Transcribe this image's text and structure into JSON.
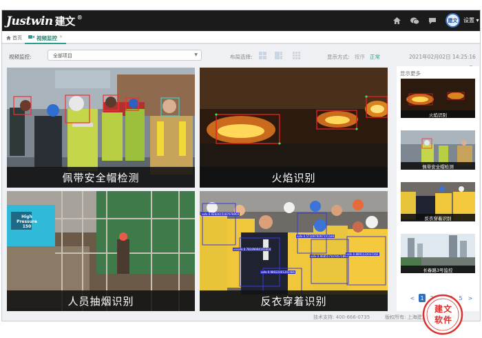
{
  "brand": {
    "logo_text": "Justwin",
    "logo_cn": "建文",
    "registered": "®"
  },
  "header": {
    "icons": [
      "home-icon",
      "wechat-icon",
      "chat-icon",
      "gear-icon"
    ],
    "avatar_text": "建文",
    "settings_label": "设置",
    "settings_arrow": "▾"
  },
  "tabs": {
    "home": "首页",
    "active": "视频监控",
    "close": "×"
  },
  "toolbar": {
    "monitor_label": "视频监控:",
    "project_value": "全部项目",
    "layout_label": "布局选择:",
    "display_label": "显示方式:",
    "display_seq": "按序",
    "display_normal": "正常",
    "datetime": "2021年02月02日 14:25:16"
  },
  "tiles": [
    {
      "caption": "佩带安全帽检测"
    },
    {
      "caption": "火焰识别"
    },
    {
      "caption": "人员抽烟识别"
    },
    {
      "caption": "反衣穿着识别"
    }
  ],
  "detection_labels": [
    "safe 0.9202615187078003",
    "safe 0.5710070097151184",
    "unsafe 0.78189994161604",
    "safe 0.9085575070571895",
    "safe 0.8891122037202",
    "safe 0.98022401202486"
  ],
  "side_panel": {
    "title": "显示更多",
    "thumbs": [
      {
        "caption": "火焰识别"
      },
      {
        "caption": "佩带安全帽检测"
      },
      {
        "caption": "反衣穿着识别"
      },
      {
        "caption": "长春路3号监控"
      }
    ],
    "pager": {
      "prev": "<",
      "pages": [
        "1",
        "2",
        "3",
        "4",
        "5"
      ],
      "next": ">",
      "current": "1"
    }
  },
  "footer": {
    "support": "技术支持: 400-666-0735",
    "copyright": "版权所有: 上海建文软件有限公司"
  },
  "stamp_text": "建文软件",
  "colors": {
    "accent": "#2a9d8f",
    "topbar": "#1b1b1b",
    "pager": "#2f6fbf",
    "stamp": "#d8322f"
  }
}
